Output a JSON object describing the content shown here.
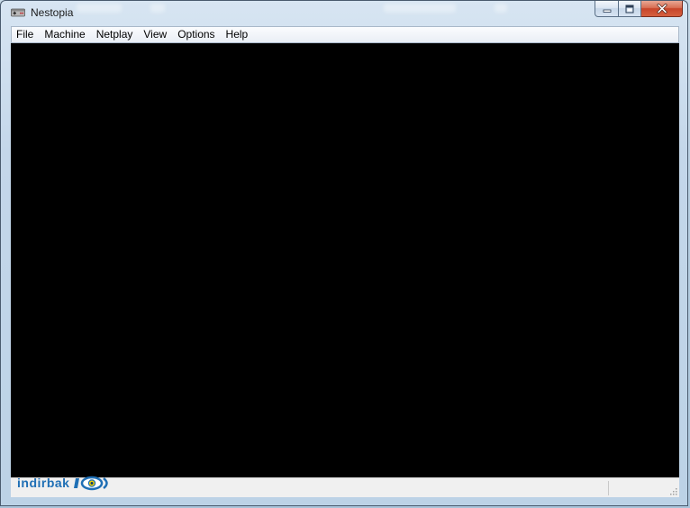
{
  "window": {
    "title": "Nestopia",
    "icon": "nes-controller-icon",
    "caption_buttons": [
      "minimize",
      "maximize",
      "close"
    ]
  },
  "menubar": {
    "items": [
      {
        "label": "File"
      },
      {
        "label": "Machine"
      },
      {
        "label": "Netplay"
      },
      {
        "label": "View"
      },
      {
        "label": "Options"
      },
      {
        "label": "Help"
      }
    ]
  },
  "display": {
    "background": "#000000"
  },
  "watermark": {
    "text": "indirbak",
    "color": "#1f6fb5"
  },
  "colors": {
    "close_button": "#c7452a",
    "frame": "#bcd2e6"
  }
}
